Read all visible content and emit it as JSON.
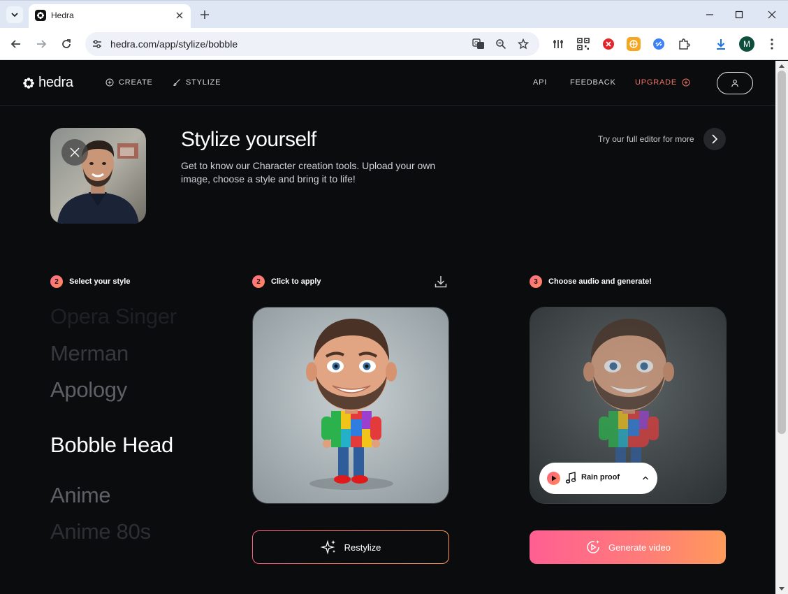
{
  "browser": {
    "tab_title": "Hedra",
    "url": "hedra.com/app/stylize/bobble",
    "profile_initial": "M"
  },
  "header": {
    "logo_text": "hedra",
    "nav": {
      "create": "CREATE",
      "stylize": "STYLIZE",
      "api": "API",
      "feedback": "FEEDBACK",
      "upgrade": "UPGRADE"
    }
  },
  "hero": {
    "title": "Stylize yourself",
    "subtitle": "Get to know our Character creation tools. Upload your own image, choose a style and bring it to life!",
    "editor_link": "Try our full editor for more"
  },
  "steps": {
    "select_style": {
      "number": "2",
      "label": "Select your style"
    },
    "click_apply": {
      "number": "2",
      "label": "Click to apply"
    },
    "choose_audio": {
      "number": "3",
      "label": "Choose audio and generate!"
    }
  },
  "styles": [
    {
      "label": "Opera Singer",
      "active": false
    },
    {
      "label": "Merman",
      "active": false
    },
    {
      "label": "Apology",
      "active": false
    },
    {
      "label": "Bobble Head",
      "active": true
    },
    {
      "label": "Anime",
      "active": false
    },
    {
      "label": "Anime 80s",
      "active": false
    }
  ],
  "audio": {
    "track": "Rain proof"
  },
  "buttons": {
    "restylize": "Restylize",
    "generate": "Generate video"
  },
  "colors": {
    "background": "#0b0c0e",
    "accent_start": "#ff5f92",
    "accent_end": "#ff9a5b",
    "upgrade": "#f0766a"
  }
}
